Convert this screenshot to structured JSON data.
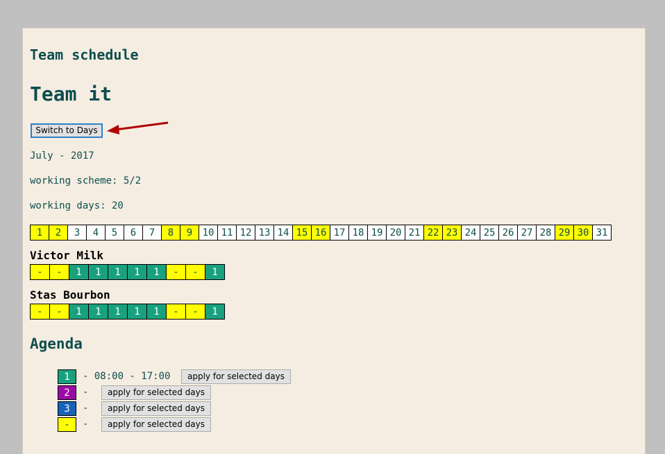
{
  "header": {
    "small_title": "Team schedule",
    "team_title": "Team it",
    "switch_label": "Switch to Days"
  },
  "info": {
    "month": "July - 2017",
    "working_scheme": "working scheme: 5/2",
    "working_days": "working days: 20"
  },
  "days": [
    {
      "n": "1",
      "weekend": true
    },
    {
      "n": "2",
      "weekend": true
    },
    {
      "n": "3",
      "weekend": false
    },
    {
      "n": "4",
      "weekend": false
    },
    {
      "n": "5",
      "weekend": false
    },
    {
      "n": "6",
      "weekend": false
    },
    {
      "n": "7",
      "weekend": false
    },
    {
      "n": "8",
      "weekend": true
    },
    {
      "n": "9",
      "weekend": true
    },
    {
      "n": "10",
      "weekend": false
    },
    {
      "n": "11",
      "weekend": false
    },
    {
      "n": "12",
      "weekend": false
    },
    {
      "n": "13",
      "weekend": false
    },
    {
      "n": "14",
      "weekend": false
    },
    {
      "n": "15",
      "weekend": true
    },
    {
      "n": "16",
      "weekend": true
    },
    {
      "n": "17",
      "weekend": false
    },
    {
      "n": "18",
      "weekend": false
    },
    {
      "n": "19",
      "weekend": false
    },
    {
      "n": "20",
      "weekend": false
    },
    {
      "n": "21",
      "weekend": false
    },
    {
      "n": "22",
      "weekend": true
    },
    {
      "n": "23",
      "weekend": true
    },
    {
      "n": "24",
      "weekend": false
    },
    {
      "n": "25",
      "weekend": false
    },
    {
      "n": "26",
      "weekend": false
    },
    {
      "n": "27",
      "weekend": false
    },
    {
      "n": "28",
      "weekend": false
    },
    {
      "n": "29",
      "weekend": true
    },
    {
      "n": "30",
      "weekend": true
    },
    {
      "n": "31",
      "weekend": false
    }
  ],
  "people": [
    {
      "name": "Victor Milk",
      "schedule": [
        "-",
        "-",
        "1",
        "1",
        "1",
        "1",
        "1",
        "-",
        "-",
        "1"
      ]
    },
    {
      "name": "Stas Bourbon",
      "schedule": [
        "-",
        "-",
        "1",
        "1",
        "1",
        "1",
        "1",
        "-",
        "-",
        "1"
      ]
    }
  ],
  "agenda": {
    "title": "Agenda",
    "button_label": "apply for selected days",
    "items": [
      {
        "code": "1",
        "text": "- 08:00 - 17:00",
        "color": "#19a17f",
        "text_color": "#ffffff"
      },
      {
        "code": "2",
        "text": "-",
        "color": "#9c0aa6",
        "text_color": "#ffffff"
      },
      {
        "code": "3",
        "text": "-",
        "color": "#1763b8",
        "text_color": "#ffffff"
      },
      {
        "code": "-",
        "text": "-",
        "color": "#ffff00",
        "text_color": "#0d4d4d"
      }
    ]
  },
  "colors": {
    "weekend": "#ffff00",
    "shift": "#19a17f",
    "heading": "#0d4d4d",
    "annotation_arrow": "#b20000"
  }
}
